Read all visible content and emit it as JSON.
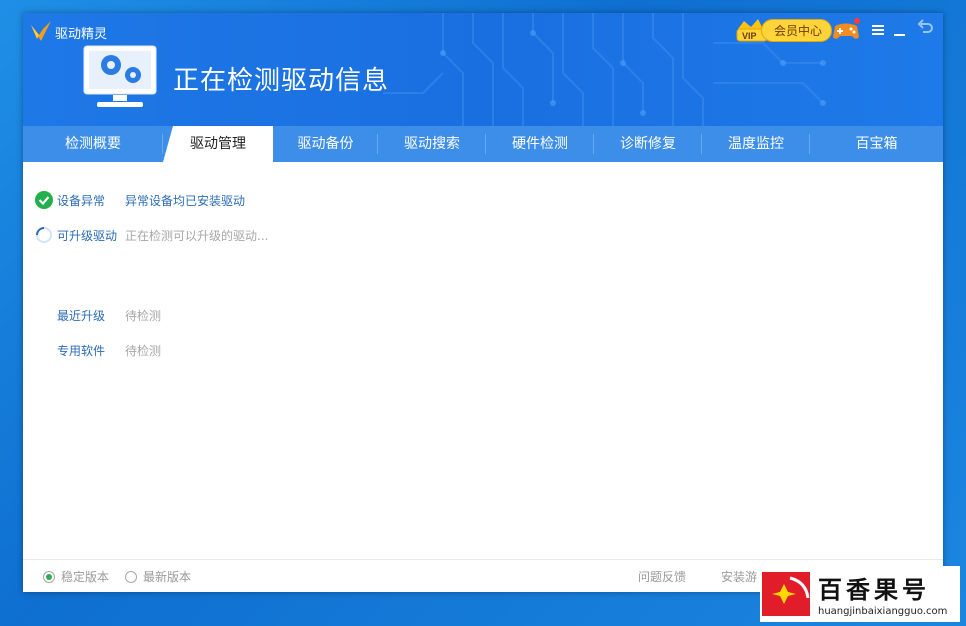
{
  "app": {
    "title": "驱动精灵"
  },
  "header": {
    "title": "正在检测驱动信息",
    "vip_label": "会员中心"
  },
  "tabs": [
    {
      "label": "检测概要",
      "active": false
    },
    {
      "label": "驱动管理",
      "active": true
    },
    {
      "label": "驱动备份",
      "active": false
    },
    {
      "label": "驱动搜索",
      "active": false
    },
    {
      "label": "硬件检测",
      "active": false
    },
    {
      "label": "诊断修复",
      "active": false
    },
    {
      "label": "温度监控",
      "active": false
    },
    {
      "label": "百宝箱",
      "active": false
    }
  ],
  "status": [
    {
      "label": "设备异常",
      "value": "异常设备均已安装驱动",
      "icon": "check-icon"
    },
    {
      "label": "可升级驱动",
      "value": "正在检测可以升级的驱动...",
      "icon": "loading-spinner-icon"
    },
    {
      "label": "最近升级",
      "value": "待检测"
    },
    {
      "label": "专用软件",
      "value": "待检测"
    }
  ],
  "footer": {
    "stable_label": "稳定版本",
    "latest_label": "最新版本",
    "selected": "stable",
    "feedback_label": "问题反馈",
    "install_label": "安装游"
  },
  "watermark": {
    "text": "百香果号",
    "url": "huangjinbaixiangguo.com"
  },
  "colors": {
    "header": "#1e78e6",
    "tabbar": "#3d8ee8",
    "accent_green": "#21b04b",
    "link": "#2c6cb5"
  }
}
